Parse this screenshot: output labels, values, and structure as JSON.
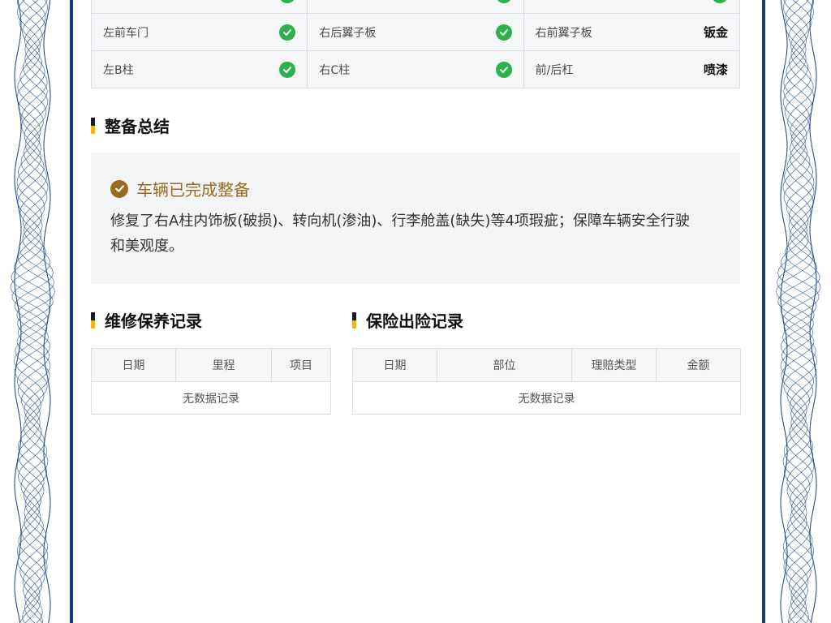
{
  "inspection": {
    "rows": [
      [
        {
          "label": "",
          "status": "ok"
        },
        {
          "label": "",
          "status": "ok"
        },
        {
          "label": "",
          "status": "ok"
        }
      ],
      [
        {
          "label": "左前车门",
          "status": "ok"
        },
        {
          "label": "右后翼子板",
          "status": "ok"
        },
        {
          "label": "右前翼子板",
          "status": "钣金"
        }
      ],
      [
        {
          "label": "左B柱",
          "status": "ok"
        },
        {
          "label": "右C柱",
          "status": "ok"
        },
        {
          "label": "前/后杠",
          "status": "喷漆"
        }
      ]
    ]
  },
  "summary": {
    "title": "整备总结",
    "status_text": "车辆已完成整备",
    "description": "修复了右A柱内饰板(破损)、转向机(渗油)、行李舱盖(缺失)等4项瑕疵；保障车辆安全行驶和美观度。"
  },
  "maintenance": {
    "title": "维修保养记录",
    "columns": [
      "日期",
      "里程",
      "项目"
    ],
    "empty_text": "无数据记录"
  },
  "insurance": {
    "title": "保险出险记录",
    "columns": [
      "日期",
      "部位",
      "理赔类型",
      "金额"
    ],
    "empty_text": "无数据记录"
  },
  "colors": {
    "frame": "#163d7a",
    "check_green": "#2bb24c",
    "summary_accent": "#9a6a1f",
    "title_bar_top": "#1a1a1a",
    "title_bar_bottom": "#f2b705"
  },
  "icons": {
    "status_ok": "check-circle-icon",
    "summary_ok": "check-circle-icon",
    "border": "guilloche-pattern"
  }
}
